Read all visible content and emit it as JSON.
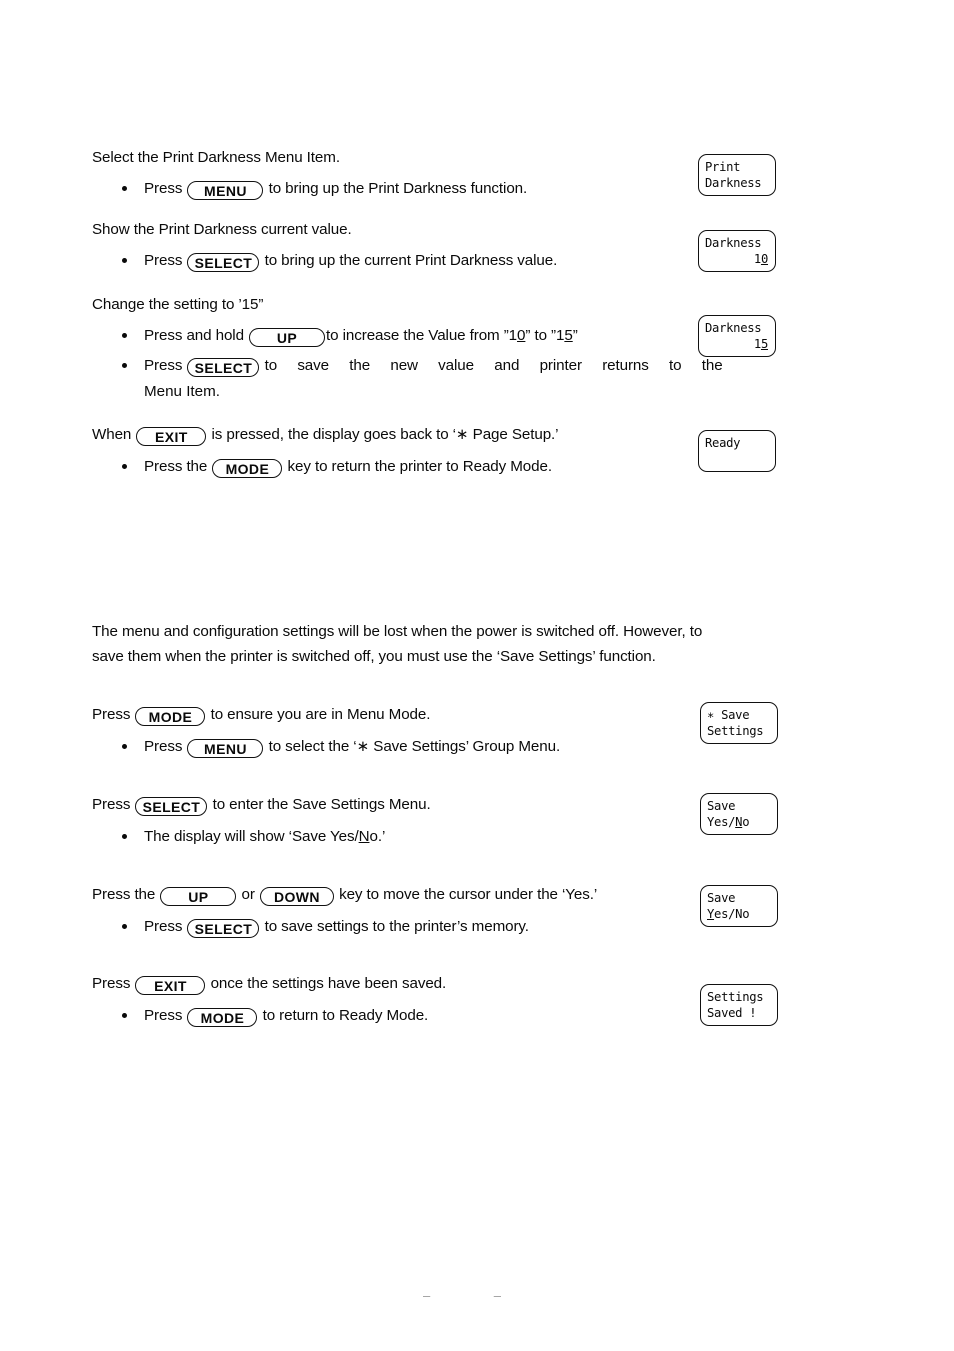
{
  "document": {
    "footer_marks": "– –"
  },
  "darkness_procedure": {
    "step1": {
      "lead": "Select the Print Darkness Menu Item.",
      "bullet_pre": "Press",
      "key": "MENU",
      "bullet_post": "to bring up the Print Darkness function.",
      "display": {
        "line1": "Print",
        "line2": "Darkness"
      }
    },
    "step2": {
      "lead": "Show the Print Darkness current value.",
      "bullet_pre": "Press",
      "key": "SELECT",
      "bullet_post": "to bring up the current Print Darkness value.",
      "display": {
        "line1": "Darkness",
        "line2_plain": "10",
        "line2_pre": "1",
        "line2_cursor": "0"
      }
    },
    "step3": {
      "lead": "Change the setting to ’15”",
      "b1_pre": "Press and hold",
      "b1_key": "UP",
      "b1_post_a": "to increase the Value from ”1",
      "b1_post_cursor1": "0",
      "b1_post_b": "” to ”1",
      "b1_post_cursor2": "5",
      "b1_post_c": "”",
      "b2_pre": "Press",
      "b2_key": "SELECT",
      "b2_post": "to save the new value and printer returns to the",
      "b2_cont": "Menu Item.",
      "display": {
        "line1": "Darkness",
        "line2_pre": "1",
        "line2_cursor": "5"
      }
    },
    "step4": {
      "lead_pre": "When",
      "lead_key": "EXIT",
      "lead_post": "is pressed, the display goes back to ‘∗ Page Setup.’",
      "bullet_pre": "Press the",
      "bullet_key": "MODE",
      "bullet_post": "key to return the printer to Ready Mode.",
      "display": {
        "line1": "Ready",
        "line2": ""
      }
    }
  },
  "save_settings_procedure": {
    "intro_line1": "The menu and configuration settings will be lost when the power is switched off. However, to",
    "intro_line2": "save them when the printer is switched off, you must use the ‘Save Settings’ function.",
    "step1": {
      "lead_pre": "Press",
      "lead_key": "MODE",
      "lead_post": "to ensure you are in Menu Mode.",
      "bullet_pre": "Press",
      "bullet_key": "MENU",
      "bullet_post": "to select the ‘∗ Save Settings’ Group Menu.",
      "display": {
        "line1": "∗ Save",
        "line2": "Settings"
      }
    },
    "step2": {
      "lead_pre": "Press",
      "lead_key": "SELECT",
      "lead_post": "to enter the Save Settings Menu.",
      "bullet_pre": "The display will show ‘Save Yes/",
      "bullet_cursor": "N",
      "bullet_post": "o.’",
      "display": {
        "line1": "Save",
        "line2_pre": "Yes/",
        "line2_cursor": "N",
        "line2_post": "o"
      }
    },
    "step3": {
      "lead_pre": "Press the",
      "lead_key1": "UP",
      "lead_mid": "or",
      "lead_key2": "DOWN",
      "lead_post": "key to move the cursor under the ‘Yes.’",
      "bullet_pre": "Press",
      "bullet_key": "SELECT",
      "bullet_post": "to save settings to the printer’s memory.",
      "display": {
        "line1": "Save",
        "line2_cursor": "Y",
        "line2_post": "es/No"
      }
    },
    "step4": {
      "lead_pre": "Press",
      "lead_key": "EXIT",
      "lead_post": "once the settings have been saved.",
      "bullet_pre": "Press",
      "bullet_key": "MODE",
      "bullet_post": "to return to Ready Mode.",
      "display": {
        "line1": "Settings",
        "line2": "Saved !"
      }
    }
  }
}
